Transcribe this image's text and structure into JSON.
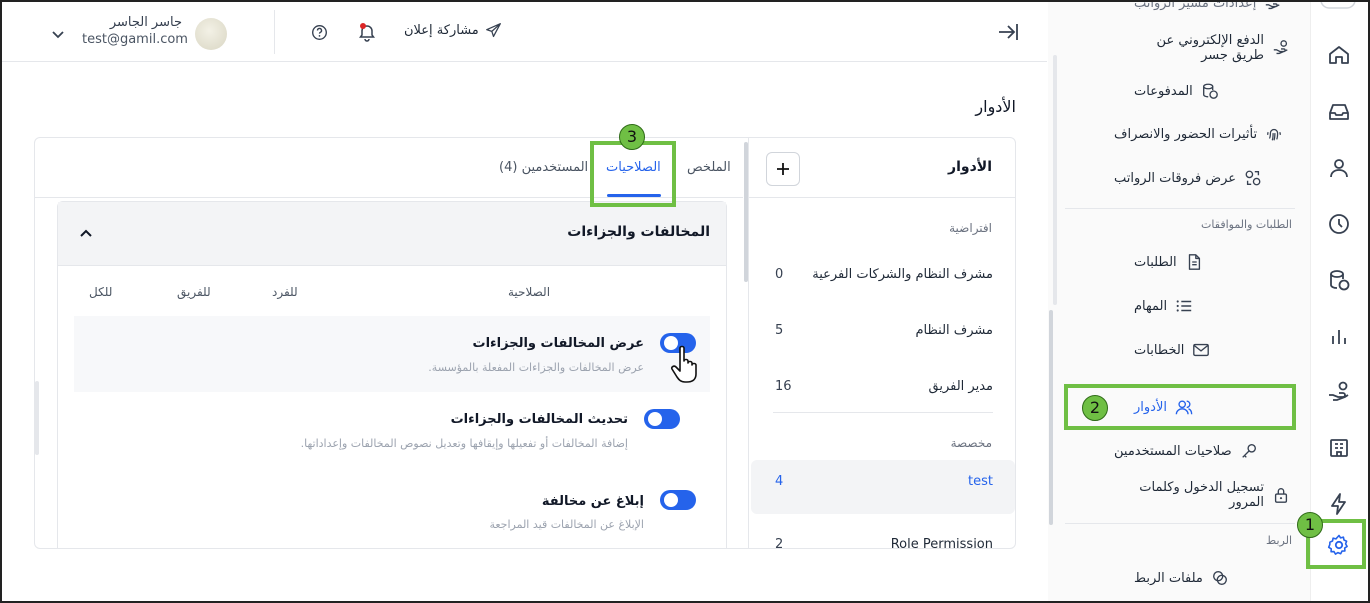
{
  "topbar": {
    "user_name": "جاسر الجاسر",
    "user_email": "test@gamil.com",
    "share_ad": "مشاركة إعلان"
  },
  "page": {
    "title": "الأدوار"
  },
  "tabs": [
    {
      "label": "الملخص"
    },
    {
      "label": "الصلاحيات"
    },
    {
      "label": "المستخدمين (4)"
    }
  ],
  "roles_panel": {
    "title": "الأدوار",
    "default_label": "افتراضية",
    "custom_label": "مخصصة",
    "default_roles": [
      {
        "name": "مشرف النظام والشركات الفرعية",
        "count": "0"
      },
      {
        "name": "مشرف النظام",
        "count": "5"
      },
      {
        "name": "مدير الفريق",
        "count": "16"
      }
    ],
    "custom_roles": [
      {
        "name": "test",
        "count": "4"
      },
      {
        "name": "Role Permission",
        "count": "2"
      }
    ]
  },
  "section": {
    "title": "المخالفات والجزاءات",
    "columns": {
      "permission": "الصلاحية",
      "individual": "للفرد",
      "team": "للفريق",
      "all": "للكل"
    },
    "permissions": [
      {
        "title": "عرض المخالفات والجزاءات",
        "desc": "عرض المخالفات والجزاءات المفعلة بالمؤسسة.",
        "enabled": true
      },
      {
        "title": "تحديث المخالفات والجزاءات",
        "desc": "إضافة المخالفات أو تفعيلها وإيقافها وتعديل نصوص المخالفات وإعداداتها.",
        "enabled": true
      },
      {
        "title": "إبلاغ عن مخالفة",
        "desc": "الإبلاغ عن المخالفات قيد المراجعة",
        "enabled": true
      }
    ]
  },
  "sidebar": {
    "items_top": [
      {
        "label": "إعدادات مسير الرواتب"
      },
      {
        "label": "الدفع الإلكتروني عن طريق جسر"
      },
      {
        "label": "المدفوعات"
      },
      {
        "label": "تأثيرات الحضور والانصراف"
      },
      {
        "label": "عرض فروقات الرواتب"
      }
    ],
    "section_requests": "الطلبات والموافقات",
    "items_requests": [
      {
        "label": "الطلبات"
      },
      {
        "label": "المهام"
      },
      {
        "label": "الخطابات"
      },
      {
        "label": "الأدوار"
      },
      {
        "label": "صلاحيات المستخدمين"
      },
      {
        "label": "تسجيل الدخول وكلمات المرور"
      }
    ],
    "section_integration": "الربط",
    "items_integration": [
      {
        "label": "ملفات الربط"
      }
    ]
  },
  "annotations": {
    "badge1": "1",
    "badge2": "2",
    "badge3": "3",
    "color": "#6fbf44"
  },
  "colors": {
    "accent": "#2563eb"
  }
}
